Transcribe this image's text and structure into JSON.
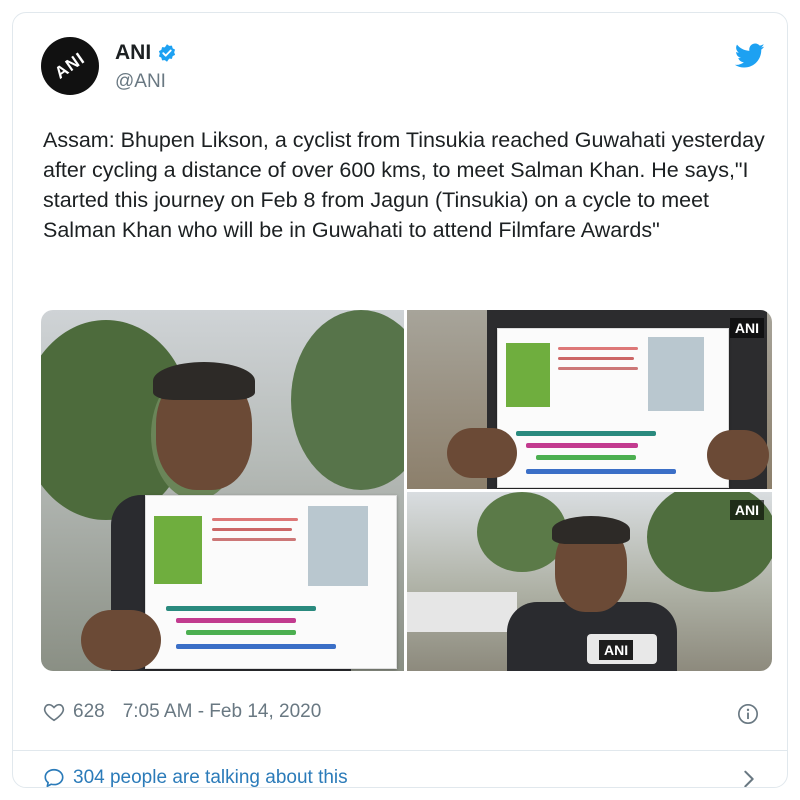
{
  "tweet": {
    "display_name": "ANI",
    "handle": "@ANI",
    "avatar_text": "ANI",
    "verified": true,
    "text": "Assam: Bhupen Likson, a cyclist from Tinsukia reached Guwahati yesterday after cycling a distance of over 600 kms, to meet Salman Khan. He says,\"I started this journey on Feb 8 from Jagun (Tinsukia) on a cycle to meet Salman Khan who will be in Guwahati to attend Filmfare Awards\"",
    "likes": "628",
    "timestamp": "7:05 AM - Feb 14, 2020",
    "talking": "304 people are talking about this"
  },
  "media": {
    "watermark": "ANI",
    "photo_count": 3
  },
  "icons": {
    "verified": "verified-badge-icon",
    "twitter": "twitter-bird-icon",
    "like": "heart-icon",
    "info": "info-icon",
    "reply": "speech-bubble-icon",
    "more": "chevron-right-icon"
  },
  "colors": {
    "accent": "#1da1f2",
    "link": "#2b7bb9",
    "muted": "#697882",
    "text": "#1c2022",
    "border": "#e1e8ed"
  }
}
